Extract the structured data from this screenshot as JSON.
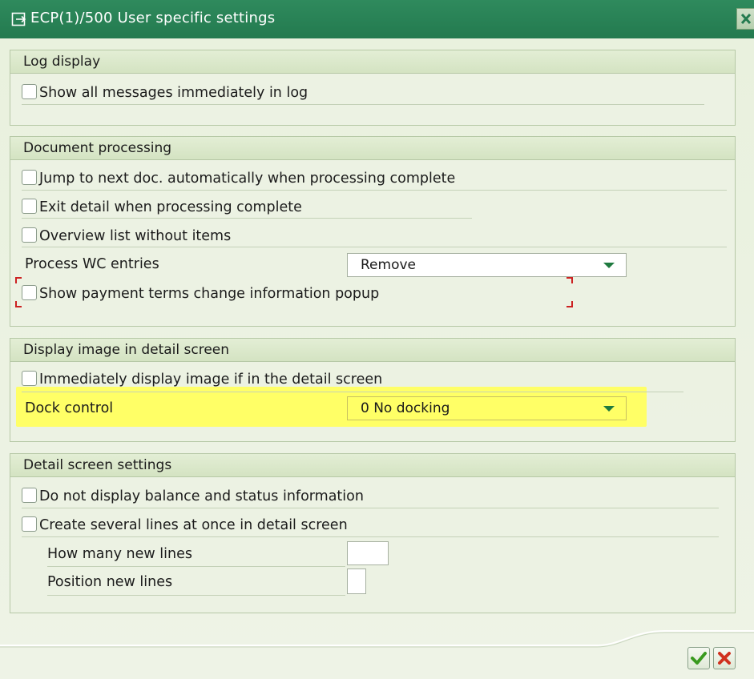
{
  "window": {
    "title": "ECP(1)/500 User specific settings",
    "icons": {
      "window_icon": "window-icon",
      "close": "close-icon"
    }
  },
  "groups": [
    {
      "title": "Log display",
      "items": [
        {
          "label": "Show all messages immediately in log",
          "checked": false
        }
      ]
    },
    {
      "title": "Document processing",
      "items": [
        {
          "label": "Jump to next doc. automatically when processing complete",
          "checked": false
        },
        {
          "label": "Exit detail when processing complete",
          "checked": false
        },
        {
          "label": "Overview list without items",
          "checked": false
        }
      ],
      "process_wc": {
        "label": "Process WC entries",
        "value": "Remove"
      },
      "popup_item": {
        "label": "Show payment terms change information popup",
        "checked": false
      }
    },
    {
      "title": "Display image in detail screen",
      "items": [
        {
          "label": "Immediately display image if in the detail screen",
          "checked": false
        }
      ],
      "dock_control": {
        "label": "Dock control",
        "value": "0 No docking"
      }
    },
    {
      "title": "Detail screen settings",
      "items": [
        {
          "label": "Do not display balance and status information",
          "checked": false
        },
        {
          "label": "Create several lines at once in detail screen",
          "checked": false
        }
      ],
      "how_many": {
        "label": "How many new lines",
        "value": ""
      },
      "position": {
        "label": "Position new lines",
        "value": ""
      }
    }
  ],
  "footer": {
    "confirm_icon": "check-icon",
    "cancel_icon": "x-icon"
  },
  "colors": {
    "titlebar": "#237a4f",
    "highlight": "#ffff66",
    "accent_green": "#1f7a3f",
    "red_mark": "#cc2222"
  }
}
